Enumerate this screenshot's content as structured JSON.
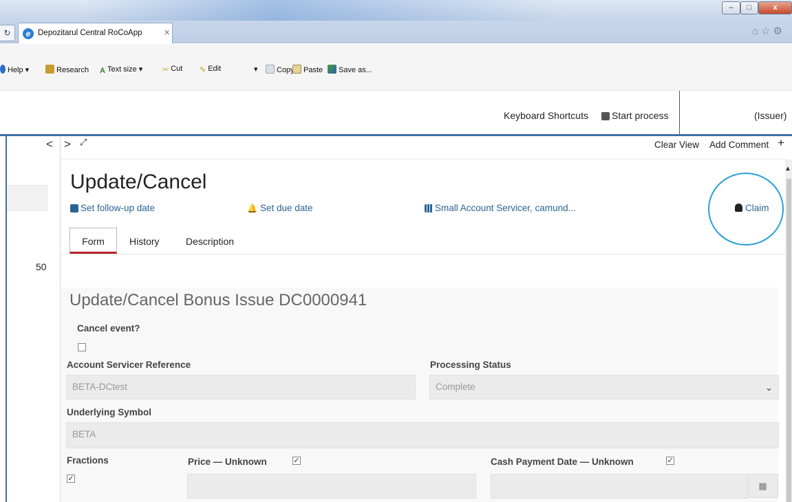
{
  "browser": {
    "tab_title": "Depozitarul Central RoCoApp",
    "tab_close": "✕",
    "refresh_icon": "↻",
    "window_buttons": {
      "minimize": "–",
      "maximize": "□",
      "close": "x"
    },
    "toolbar_icons": "⌂☆⚙"
  },
  "command_bar": {
    "help": "Help ▾",
    "research": "Research",
    "text_size": "Text size ▾",
    "cut": "Cut",
    "edit": "Edit",
    "edit_dropdown": "▾",
    "copy": "Copy",
    "paste": "Paste",
    "save_as": "Save as..."
  },
  "app_header": {
    "keyboard_shortcuts": "Keyboard Shortcuts",
    "start_process": "Start process",
    "user_role": "(Issuer)"
  },
  "left_panel": {
    "count": "50"
  },
  "task_nav": {
    "prev": "<",
    "next": ">",
    "expand": "⤢",
    "clear_view": "Clear View",
    "add_comment": "Add Comment",
    "add_comment_plus": "+"
  },
  "task": {
    "title": "Update/Cancel",
    "follow_up": "Set follow-up date",
    "due_date": "Set due date",
    "candidate_groups": "Small Account Servicer, camund...",
    "claim": "Claim",
    "tabs": [
      "Form",
      "History",
      "Description"
    ]
  },
  "form": {
    "title": "Update/Cancel Bonus Issue DC0000941",
    "cancel_event_label": "Cancel event?",
    "account_servicer_reference_label": "Account Servicer Reference",
    "account_servicer_reference_value": "BETA-DCtest",
    "processing_status_label": "Processing Status",
    "processing_status_value": "Complete",
    "underlying_symbol_label": "Underlying Symbol",
    "underlying_symbol_value": "BETA",
    "fractions_label": "Fractions",
    "price_label": "Price  —  Unknown",
    "cash_payment_date_label": "Cash Payment Date  —  Unknown",
    "check_mark": "✓"
  },
  "colors": {
    "accent_blue": "#3d6fa5",
    "link_blue": "#2a6496",
    "tab_underline": "#b4242c",
    "claim_highlight": "#2a9fd8"
  }
}
